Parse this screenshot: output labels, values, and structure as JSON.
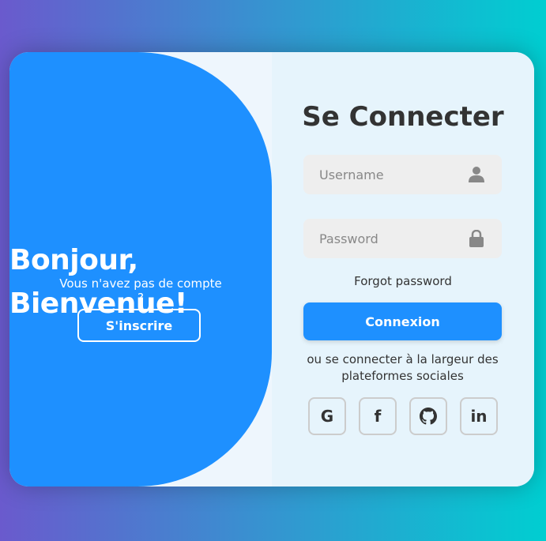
{
  "welcome": {
    "line1": "Bonjour,",
    "line2": "Bienvenue!",
    "subtitle": "Vous n'avez pas de compte ?",
    "signup_label": "S'inscrire"
  },
  "login": {
    "title": "Se Connecter",
    "username_placeholder": "Username",
    "username_icon": "user-icon",
    "password_placeholder": "Password",
    "password_icon": "lock-icon",
    "forgot_label": "Forgot password",
    "submit_label": "Connexion",
    "social_text": "ou se connecter à la largeur des plateformes sociales",
    "socials": [
      {
        "name": "google-icon",
        "glyph": "G"
      },
      {
        "name": "facebook-icon",
        "glyph": "f"
      },
      {
        "name": "github-icon",
        "glyph": ""
      },
      {
        "name": "linkedin-icon",
        "glyph": "in"
      }
    ]
  },
  "colors": {
    "accent": "#1e90ff",
    "panel": "#e6f4fc",
    "field_bg": "#eeeeee"
  }
}
